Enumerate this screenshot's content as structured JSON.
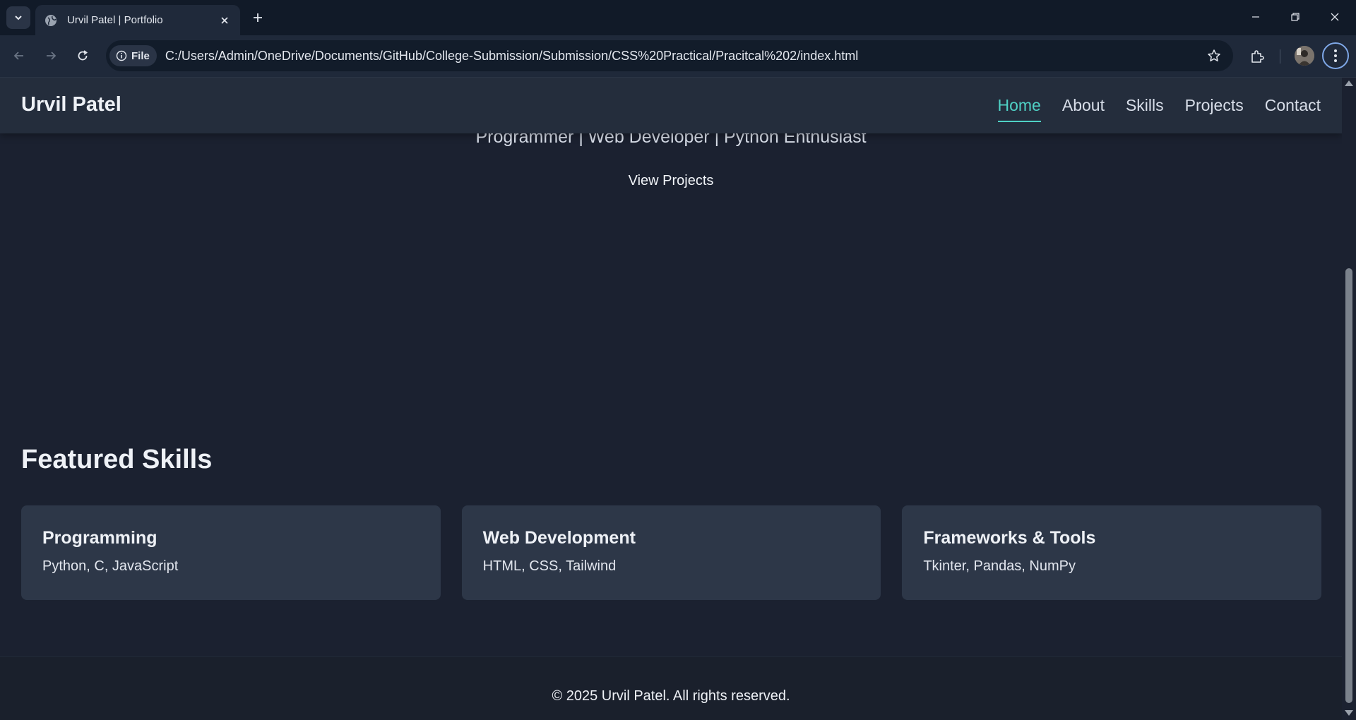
{
  "browser": {
    "tab_title": "Urvil Patel | Portfolio",
    "site_info_label": "File",
    "url": "C:/Users/Admin/OneDrive/Documents/GitHub/College-Submission/Submission/CSS%20Practical/Pracitcal%202/index.html"
  },
  "site": {
    "brand": "Urvil Patel",
    "nav": [
      {
        "label": "Home",
        "active": true
      },
      {
        "label": "About",
        "active": false
      },
      {
        "label": "Skills",
        "active": false
      },
      {
        "label": "Projects",
        "active": false
      },
      {
        "label": "Contact",
        "active": false
      }
    ],
    "accent_color": "#4fd1c5"
  },
  "hero": {
    "subtitle": "Programmer | Web Developer | Python Enthusiast",
    "button_label": "View Projects"
  },
  "skills": {
    "title": "Featured Skills",
    "cards": [
      {
        "title": "Programming",
        "text": "Python, C, JavaScript"
      },
      {
        "title": "Web Development",
        "text": "HTML, CSS, Tailwind"
      },
      {
        "title": "Frameworks & Tools",
        "text": "Tkinter, Pandas, NumPy"
      }
    ]
  },
  "footer": {
    "text": "© 2025 Urvil Patel. All rights reserved."
  }
}
